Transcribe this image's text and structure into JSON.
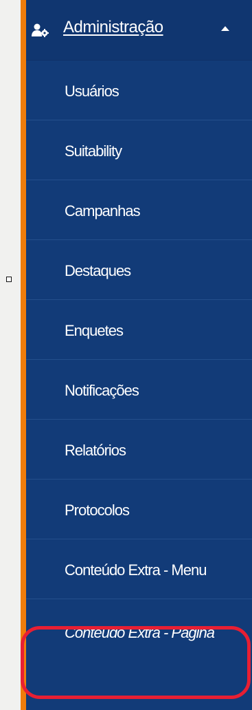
{
  "sidebar": {
    "header": {
      "label": "Administração",
      "icon": "user-gear-icon",
      "expanded_indicator": "caret-up-icon"
    },
    "items": [
      {
        "label": "Usuários"
      },
      {
        "label": "Suitability"
      },
      {
        "label": "Campanhas"
      },
      {
        "label": "Destaques"
      },
      {
        "label": "Enquetes"
      },
      {
        "label": "Notificações"
      },
      {
        "label": "Relatórios"
      },
      {
        "label": "Protocolos"
      },
      {
        "label": "Conteúdo Extra - Menu"
      },
      {
        "label": "Conteúdo Extra - Página",
        "active": true
      }
    ]
  },
  "colors": {
    "sidebar_bg": "#123b78",
    "header_bg": "#103670",
    "accent_bar": "#ef7d0b",
    "highlight": "#e81f33",
    "text": "#ffffff"
  }
}
